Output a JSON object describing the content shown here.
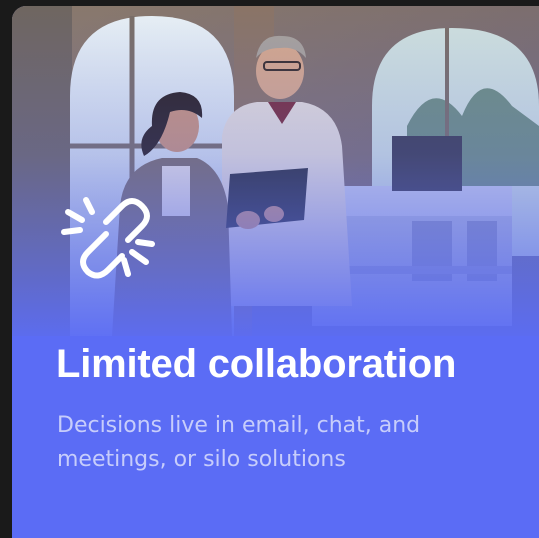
{
  "card": {
    "title": "Limited collaboration",
    "description": "Decisions live in email, chat, and meetings, or silo solutions",
    "icon": "broken-link-icon",
    "photo": "people-reviewing-building-model-photo"
  },
  "colors": {
    "card_blue": "#5b6ef5",
    "title_text": "#ffffff",
    "description_text": "#c7cdfb"
  }
}
